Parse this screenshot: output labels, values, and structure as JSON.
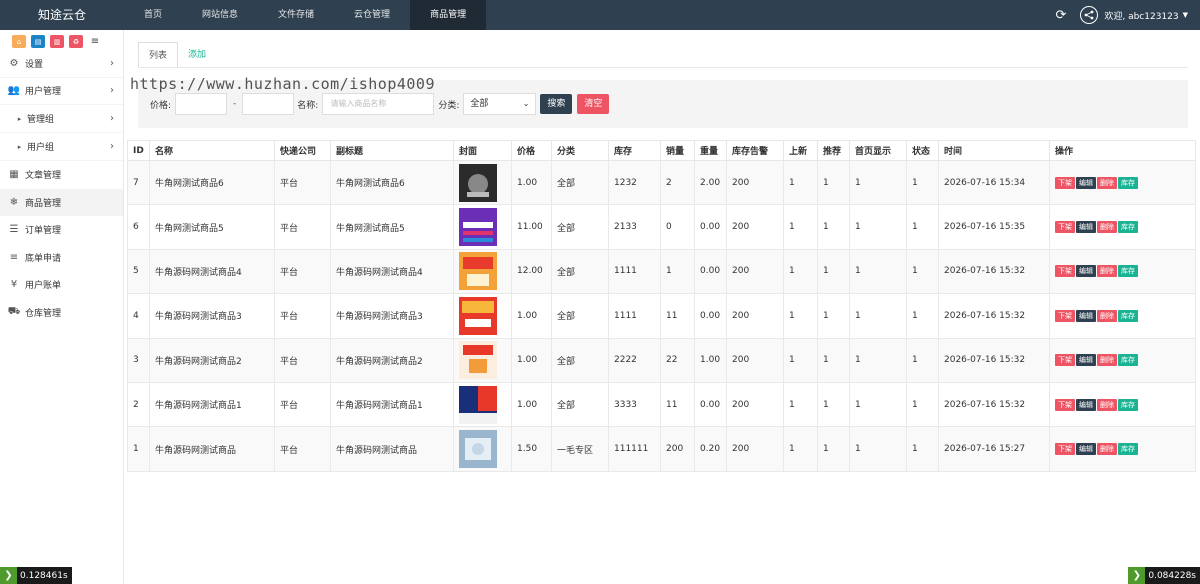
{
  "app": {
    "brand": "知途云仓"
  },
  "topnav": [
    {
      "label": "首页",
      "active": false
    },
    {
      "label": "网站信息",
      "active": false
    },
    {
      "label": "文件存储",
      "active": false
    },
    {
      "label": "云仓管理",
      "active": false
    },
    {
      "label": "商品管理",
      "active": true
    }
  ],
  "user": {
    "welcome": "欢迎, abc123123"
  },
  "sidebar": {
    "menu": [
      {
        "label": "设置",
        "icon": "gears-icon",
        "chevron": true
      },
      {
        "label": "用户管理",
        "icon": "users-icon",
        "chevron": true
      },
      {
        "label": "管理组",
        "icon": "caret-right-icon",
        "chevron": true,
        "sub": true
      },
      {
        "label": "用户组",
        "icon": "caret-right-icon",
        "chevron": true,
        "sub": true
      },
      {
        "label": "文章管理",
        "icon": "newspaper-icon"
      },
      {
        "label": "商品管理",
        "icon": "snowflake-icon"
      },
      {
        "label": "订单管理",
        "icon": "list-alt-icon"
      },
      {
        "label": "底单申请",
        "icon": "bars-icon"
      },
      {
        "label": "用户账单",
        "icon": "yen-icon"
      },
      {
        "label": "仓库管理",
        "icon": "truck-icon"
      }
    ]
  },
  "tabs": {
    "list": "列表",
    "add": "添加"
  },
  "watermark": "https://www.huzhan.com/ishop4009",
  "filter": {
    "price_label": "价格:",
    "dash": "-",
    "name_label": "名称:",
    "name_placeholder": "请输入商品名称",
    "category_label": "分类:",
    "category_value": "全部",
    "search_btn": "搜索",
    "clear_btn": "清空"
  },
  "table": {
    "headers": [
      "ID",
      "名称",
      "快递公司",
      "副标题",
      "封面",
      "价格",
      "分类",
      "库存",
      "销量",
      "重量",
      "库存告警",
      "上新",
      "推荐",
      "首页显示",
      "状态",
      "时间",
      "操作"
    ],
    "actions": {
      "off": "下架",
      "edit": "编辑",
      "delete": "删除",
      "stock": "库存"
    },
    "rows": [
      {
        "id": "7",
        "name": "牛角网测试商品6",
        "courier": "平台",
        "subtitle": "牛角网测试商品6",
        "price": "1.00",
        "category": "全部",
        "stock": "1232",
        "sales": "2",
        "weight": "2.00",
        "alert": "200",
        "new": "1",
        "recommend": "1",
        "home": "1",
        "status": "1",
        "time": "2026-07-16 15:34"
      },
      {
        "id": "6",
        "name": "牛角网测试商品5",
        "courier": "平台",
        "subtitle": "牛角网测试商品5",
        "price": "11.00",
        "category": "全部",
        "stock": "2133",
        "sales": "0",
        "weight": "0.00",
        "alert": "200",
        "new": "1",
        "recommend": "1",
        "home": "1",
        "status": "1",
        "time": "2026-07-16 15:35"
      },
      {
        "id": "5",
        "name": "牛角源码网测试商品4",
        "courier": "平台",
        "subtitle": "牛角源码网测试商品4",
        "price": "12.00",
        "category": "全部",
        "stock": "1111",
        "sales": "1",
        "weight": "0.00",
        "alert": "200",
        "new": "1",
        "recommend": "1",
        "home": "1",
        "status": "1",
        "time": "2026-07-16 15:32"
      },
      {
        "id": "4",
        "name": "牛角源码网测试商品3",
        "courier": "平台",
        "subtitle": "牛角源码网测试商品3",
        "price": "1.00",
        "category": "全部",
        "stock": "1111",
        "sales": "11",
        "weight": "0.00",
        "alert": "200",
        "new": "1",
        "recommend": "1",
        "home": "1",
        "status": "1",
        "time": "2026-07-16 15:32"
      },
      {
        "id": "3",
        "name": "牛角源码网测试商品2",
        "courier": "平台",
        "subtitle": "牛角源码网测试商品2",
        "price": "1.00",
        "category": "全部",
        "stock": "2222",
        "sales": "22",
        "weight": "1.00",
        "alert": "200",
        "new": "1",
        "recommend": "1",
        "home": "1",
        "status": "1",
        "time": "2026-07-16 15:32"
      },
      {
        "id": "2",
        "name": "牛角源码网测试商品1",
        "courier": "平台",
        "subtitle": "牛角源码网测试商品1",
        "price": "1.00",
        "category": "全部",
        "stock": "3333",
        "sales": "11",
        "weight": "0.00",
        "alert": "200",
        "new": "1",
        "recommend": "1",
        "home": "1",
        "status": "1",
        "time": "2026-07-16 15:32"
      },
      {
        "id": "1",
        "name": "牛角源码网测试商品",
        "courier": "平台",
        "subtitle": "牛角源码网测试商品",
        "price": "1.50",
        "category": "一毛专区",
        "stock": "111111",
        "sales": "200",
        "weight": "0.20",
        "alert": "200",
        "new": "1",
        "recommend": "1",
        "home": "1",
        "status": "1",
        "time": "2026-07-16 15:27"
      }
    ]
  },
  "timers": {
    "left": "0.128461s",
    "right": "0.084228s"
  },
  "colors": {
    "nav_bg": "#2f4050",
    "accent_green": "#1ab394",
    "danger_red": "#ed5565"
  }
}
